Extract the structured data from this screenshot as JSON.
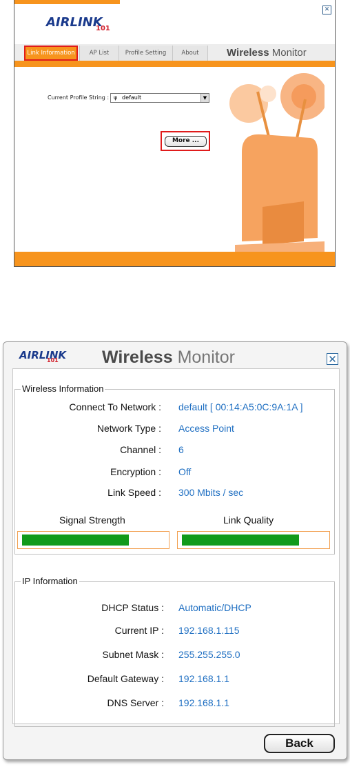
{
  "top_window": {
    "logo": {
      "brand": "AIRLINK",
      "number": "101"
    },
    "close_glyph": "✕",
    "tabs": [
      {
        "label": "Link Information",
        "active": true
      },
      {
        "label": "AP List",
        "active": false
      },
      {
        "label": "Profile Setting",
        "active": false
      },
      {
        "label": "About",
        "active": false
      }
    ],
    "title_bold": "Wireless",
    "title_light": "Monitor",
    "profile": {
      "label": "Current Profile String :",
      "value": "default"
    },
    "more_label": "More ..."
  },
  "bottom_window": {
    "logo": {
      "brand": "AIRLINK",
      "number": "101"
    },
    "title_bold": "Wireless",
    "title_light": "Monitor",
    "close_glyph": "✕",
    "wireless": {
      "legend": "Wireless Information",
      "rows": [
        {
          "label": "Connect To Network :",
          "value": "default [ 00:14:A5:0C:9A:1A ]"
        },
        {
          "label": "Network Type :",
          "value": "Access Point"
        },
        {
          "label": "Channel :",
          "value": "6"
        },
        {
          "label": "Encryption :",
          "value": "Off"
        },
        {
          "label": "Link Speed :",
          "value": "300 Mbits / sec"
        }
      ],
      "signal_label": "Signal Strength",
      "signal_level": 0.75,
      "quality_label": "Link Quality",
      "quality_level": 0.82
    },
    "ip": {
      "legend": "IP Information",
      "rows": [
        {
          "label": "DHCP Status :",
          "value": "Automatic/DHCP"
        },
        {
          "label": "Current IP :",
          "value": "192.168.1.115"
        },
        {
          "label": "Subnet Mask :",
          "value": "255.255.255.0"
        },
        {
          "label": "Default Gateway :",
          "value": "192.168.1.1"
        },
        {
          "label": "DNS Server :",
          "value": "192.168.1.1"
        }
      ]
    },
    "back_label": "Back"
  },
  "colors": {
    "accent": "#f7941d",
    "highlight": "#e01b1b",
    "value_text": "#1f6fc2",
    "meter_fill": "#129a1a"
  }
}
